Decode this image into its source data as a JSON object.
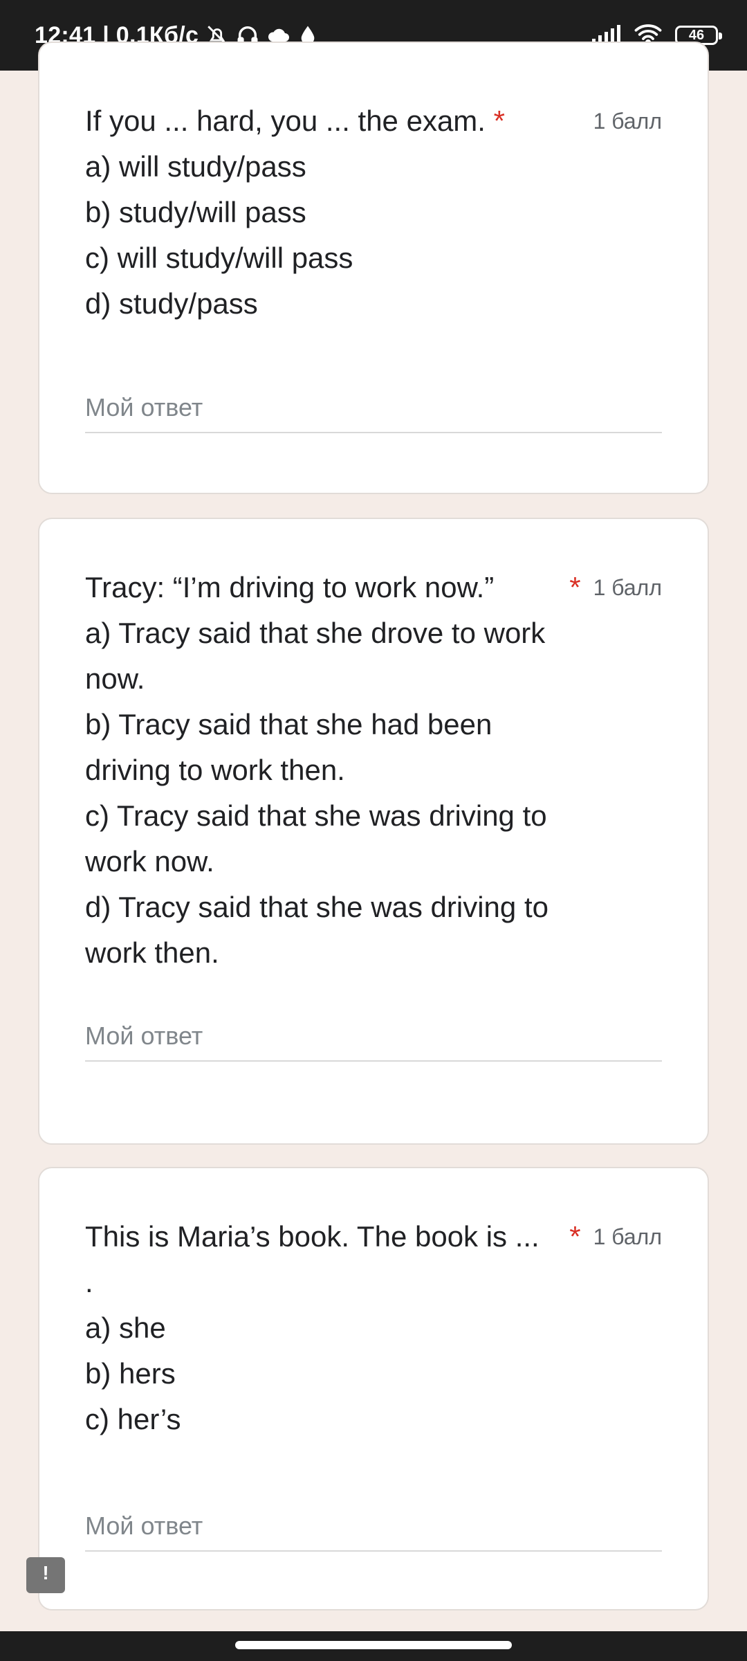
{
  "status_bar": {
    "time_speed": "12:41 | 0,1Кб/с",
    "battery_level": "46",
    "icons": [
      "bell-off-icon",
      "headphones-icon",
      "cloud-icon",
      "drop-icon",
      "signal-icon",
      "wifi-icon",
      "battery-icon"
    ]
  },
  "questions": [
    {
      "text": "If you ... hard, you ... the exam.",
      "required_mark": "*",
      "points": "1 балл",
      "options": [
        "a) will study/pass",
        "b) study/will pass",
        "c) will study/will pass",
        "d) study/pass"
      ],
      "answer_placeholder": "Мой ответ"
    },
    {
      "text": "Tracy: “I’m driving to work now.”",
      "required_mark": "*",
      "points": "1 балл",
      "options": [
        "a) Tracy said that she drove to work now.",
        "b) Tracy said that she had been driving to work then.",
        "c) Tracy said that she was driving to work now.",
        "d) Tracy said that she was driving to work then."
      ],
      "answer_placeholder": "Мой ответ"
    },
    {
      "text": "This is Maria’s book. The book is ... .",
      "required_mark": "*",
      "points": "1 балл",
      "options": [
        "a) she",
        "b) hers",
        "c) her’s"
      ],
      "answer_placeholder": "Мой ответ"
    }
  ],
  "feedback_button": {
    "icon": "report-icon",
    "glyph": "!"
  },
  "colors": {
    "page_background": "#f5ece7",
    "required": "#d93025",
    "status_bar": "#1e1e1e"
  }
}
